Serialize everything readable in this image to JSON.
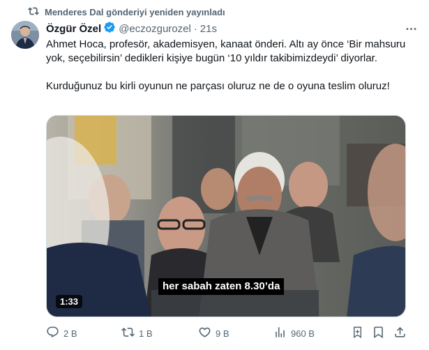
{
  "repost": {
    "text": "Menderes Dal gönderiyi yeniden yayınladı",
    "icon": "repost-icon"
  },
  "author": {
    "name": "Özgür Özel",
    "handle": "@eczozgurozel",
    "time": "21s",
    "verified_color": "#1d9bf0"
  },
  "tweet": {
    "paragraphs": [
      "Ahmet Hoca, profesör, akademisyen, kanaat önderi. Altı ay önce ‘Bir mahsuru yok, seçebilirsin’ dedikleri kişiye bugün ‘10 yıldır takibimizdeydi’ diyorlar.",
      "Kurduğunuz bu kirli oyunun ne parçası oluruz ne de o oyuna teslim oluruz!"
    ]
  },
  "media": {
    "subtitle": "her sabah zaten 8.30’da",
    "duration": "1:33"
  },
  "actions": {
    "replies": "2 B",
    "reposts": "1 B",
    "likes": "9 B",
    "views": "960 B",
    "accent": "#1d9bf0"
  }
}
